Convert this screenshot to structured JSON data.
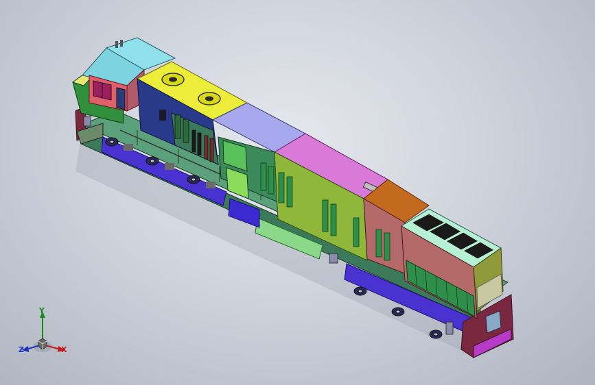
{
  "viewport": {
    "background_top": "#e6e8ee",
    "background_bottom": "#aeb3bf"
  },
  "model": {
    "part_colors": {
      "cab": "#7dd3e0",
      "nose": "#2f8f3a",
      "radiator_hood": "#ecec3a",
      "fan": "#d8d81a",
      "blower_hood": "#a8a8ee",
      "engine_hood": "#d97ad9",
      "equipment_hood": "#c46a1f",
      "dynamic_brake": "#b5f0d5",
      "long_hood_side": "#8fb83a",
      "rear_cab_side": "#b56a6a",
      "walkway": "#3a7a5a",
      "trucks": "#4a32d0",
      "fuel_tank": "#8ad88a",
      "pilot": "#7a2840",
      "windows": "#9a2060",
      "grille": "#2f8f4a"
    }
  },
  "triad": {
    "x_label": "X",
    "y_label": "Y",
    "z_label": "Z",
    "x_color": "#c01818",
    "y_color": "#1a8a1a",
    "z_color": "#1a2fc0"
  }
}
